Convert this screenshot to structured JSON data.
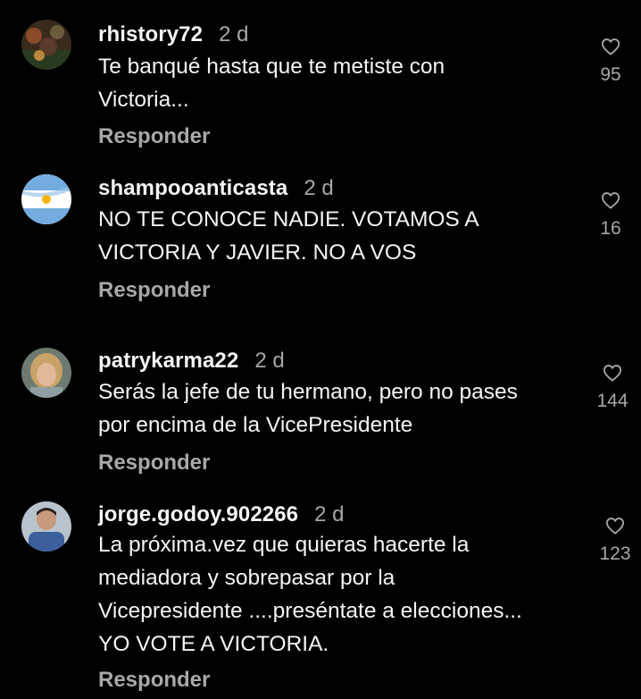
{
  "comments": [
    {
      "username": "rhistory72",
      "time": "2 d",
      "text": "Te banqué hasta que te metiste con\nVictoria...",
      "reply_label": "Responder",
      "likes": "95",
      "avatar": "photo-avatar"
    },
    {
      "username": "shampooanticasta",
      "time": "2 d",
      "text": "NO TE CONOCE NADIE. VOTAMOS A\nVICTORIA Y JAVIER. NO A VOS",
      "reply_label": "Responder",
      "likes": "16",
      "avatar": "argentina-flag-avatar"
    },
    {
      "username": "patrykarma22",
      "time": "2 d",
      "text": "Serás la jefe de tu hermano, pero no pases\npor encima de la VicePresidente",
      "reply_label": "Responder",
      "likes": "144",
      "avatar": "photo-avatar"
    },
    {
      "username": "jorge.godoy.902266",
      "time": "2 d",
      "text": "La próxima.vez que quieras hacerte la\nmediadora y sobrepasar por la\nVicepresidente ....preséntate a elecciones...\nYO VOTE A VICTORIA.",
      "reply_label": "Responder",
      "likes": "123",
      "avatar": "photo-avatar"
    }
  ],
  "colors": {
    "background": "#000000",
    "primary_text": "#f5f5f5",
    "secondary_text": "#a8a8a8"
  },
  "icons": {
    "like": "heart-outline-icon"
  }
}
